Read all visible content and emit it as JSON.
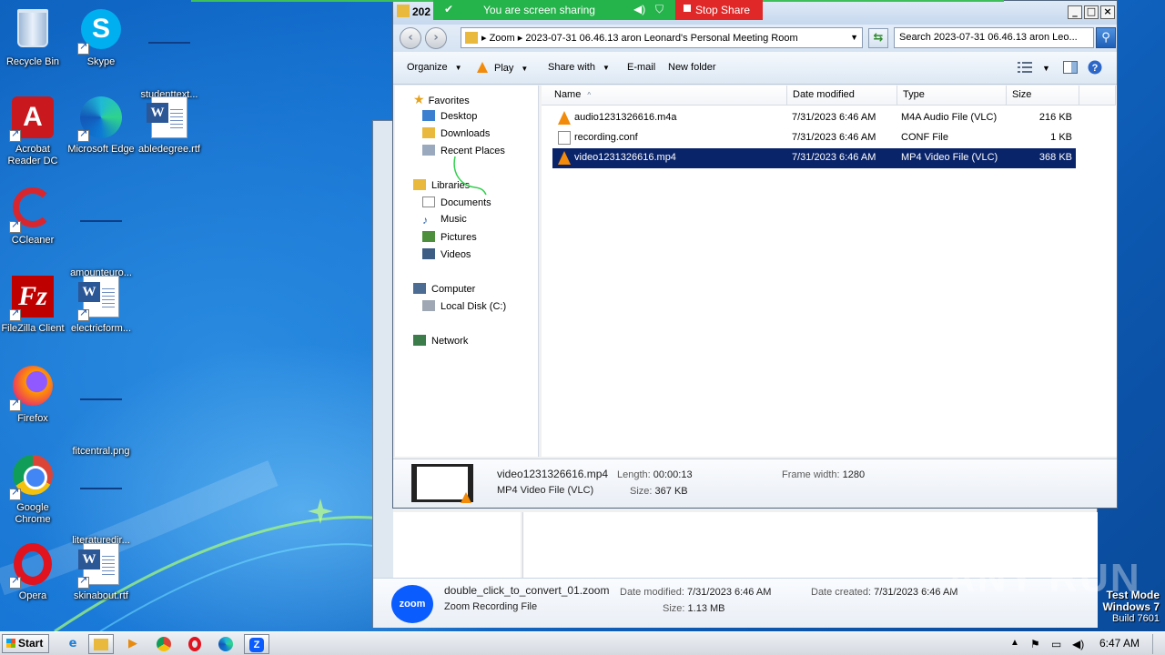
{
  "desktop": {
    "icons": [
      {
        "label": "Recycle Bin",
        "icon": "recycle-bin-icon"
      },
      {
        "label": "Skype",
        "icon": "skype-icon"
      },
      {
        "label": "studenttext...",
        "icon": "blank-file-icon"
      },
      {
        "label": "Acrobat Reader DC",
        "icon": "acrobat-reader-icon"
      },
      {
        "label": "Microsoft Edge",
        "icon": "edge-icon"
      },
      {
        "label": "abledegree.rtf",
        "icon": "word-document-icon"
      },
      {
        "label": "CCleaner",
        "icon": "ccleaner-icon"
      },
      {
        "label": "amounteuro...",
        "icon": "blank-file-icon"
      },
      {
        "label": "FileZilla Client",
        "icon": "filezilla-icon"
      },
      {
        "label": "electricform...",
        "icon": "word-document-icon"
      },
      {
        "label": "Firefox",
        "icon": "firefox-icon"
      },
      {
        "label": "fitcentral.png",
        "icon": "blank-file-icon"
      },
      {
        "label": "Google Chrome",
        "icon": "chrome-icon"
      },
      {
        "label": "literaturedir...",
        "icon": "blank-file-icon"
      },
      {
        "label": "Opera",
        "icon": "opera-icon"
      },
      {
        "label": "skinabout.rtf",
        "icon": "word-document-icon"
      }
    ]
  },
  "share_banner": {
    "status": "You are screen sharing",
    "stop_label": "Stop Share"
  },
  "window": {
    "title": "202",
    "address": {
      "crumb_root": "Zoom",
      "crumb_folder": "2023-07-31 06.46.13 aron Leonard's Personal Meeting Room"
    },
    "search_placeholder": "Search 2023-07-31 06.46.13 aron Leo...",
    "toolbar": {
      "organize": "Organize",
      "play": "Play",
      "share_with": "Share with",
      "email": "E-mail",
      "new_folder": "New folder"
    },
    "nav": {
      "favorites": "Favorites",
      "desktop": "Desktop",
      "downloads": "Downloads",
      "recent": "Recent Places",
      "libraries": "Libraries",
      "documents": "Documents",
      "music": "Music",
      "pictures": "Pictures",
      "videos": "Videos",
      "computer": "Computer",
      "local_disk": "Local Disk (C:)",
      "network": "Network"
    },
    "columns": {
      "name": "Name",
      "date": "Date modified",
      "type": "Type",
      "size": "Size"
    },
    "files": [
      {
        "name": "audio1231326616.m4a",
        "date": "7/31/2023 6:46 AM",
        "type": "M4A Audio File (VLC)",
        "size": "216 KB",
        "selected": false,
        "icon": "vlc-icon"
      },
      {
        "name": "recording.conf",
        "date": "7/31/2023 6:46 AM",
        "type": "CONF File",
        "size": "1 KB",
        "selected": false,
        "icon": "file-icon"
      },
      {
        "name": "video1231326616.mp4",
        "date": "7/31/2023 6:46 AM",
        "type": "MP4 Video File (VLC)",
        "size": "368 KB",
        "selected": true,
        "icon": "vlc-icon"
      }
    ],
    "details": {
      "name": "video1231326616.mp4",
      "type": "MP4 Video File (VLC)",
      "length_label": "Length:",
      "length": "00:00:13",
      "size_label": "Size:",
      "size": "367 KB",
      "frame_width_label": "Frame width:",
      "frame_width": "1280"
    }
  },
  "bg_window": {
    "details": {
      "name": "double_click_to_convert_01.zoom",
      "type": "Zoom Recording File",
      "badge": "zoom",
      "date_modified_label": "Date modified:",
      "date_modified": "7/31/2023 6:46 AM",
      "date_created_label": "Date created:",
      "date_created": "7/31/2023 6:46 AM",
      "size_label": "Size:",
      "size": "1.13 MB"
    }
  },
  "watermark": {
    "text": "ANY RUN"
  },
  "os_notice": {
    "line1": "Test Mode",
    "line2": "Windows 7",
    "line3": "Build 7601"
  },
  "taskbar": {
    "start_label": "Start",
    "clock": "6:47 AM"
  }
}
